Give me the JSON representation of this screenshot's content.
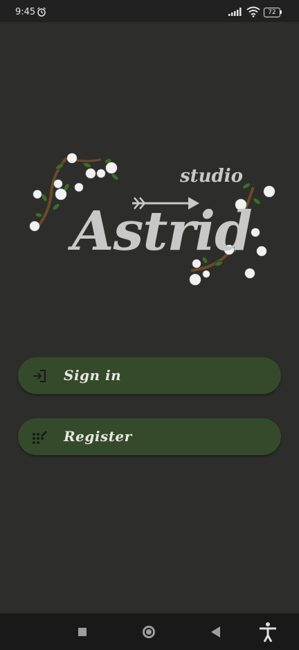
{
  "status_bar": {
    "time": "9:45",
    "battery": "72",
    "icons": [
      "alarm-icon",
      "signal-icon",
      "wifi-icon",
      "battery-icon"
    ]
  },
  "logo": {
    "brand": "Astrid",
    "suffix": "studio",
    "colors": {
      "text": "#c8c8c8",
      "leaves": "#3f6a2e",
      "flowers": "#f2f2f2",
      "vine": "#6b4a2a"
    }
  },
  "buttons": {
    "sign_in": {
      "label": "Sign in",
      "icon": "login-icon"
    },
    "register": {
      "label": "Register",
      "icon": "register-icon"
    }
  },
  "nav": {
    "icons": [
      "recents-icon",
      "home-icon",
      "back-icon",
      "accessibility-icon"
    ]
  },
  "colors": {
    "background": "#2d2d2b",
    "button": "#354a2a",
    "button_text": "#e8e8e2"
  }
}
